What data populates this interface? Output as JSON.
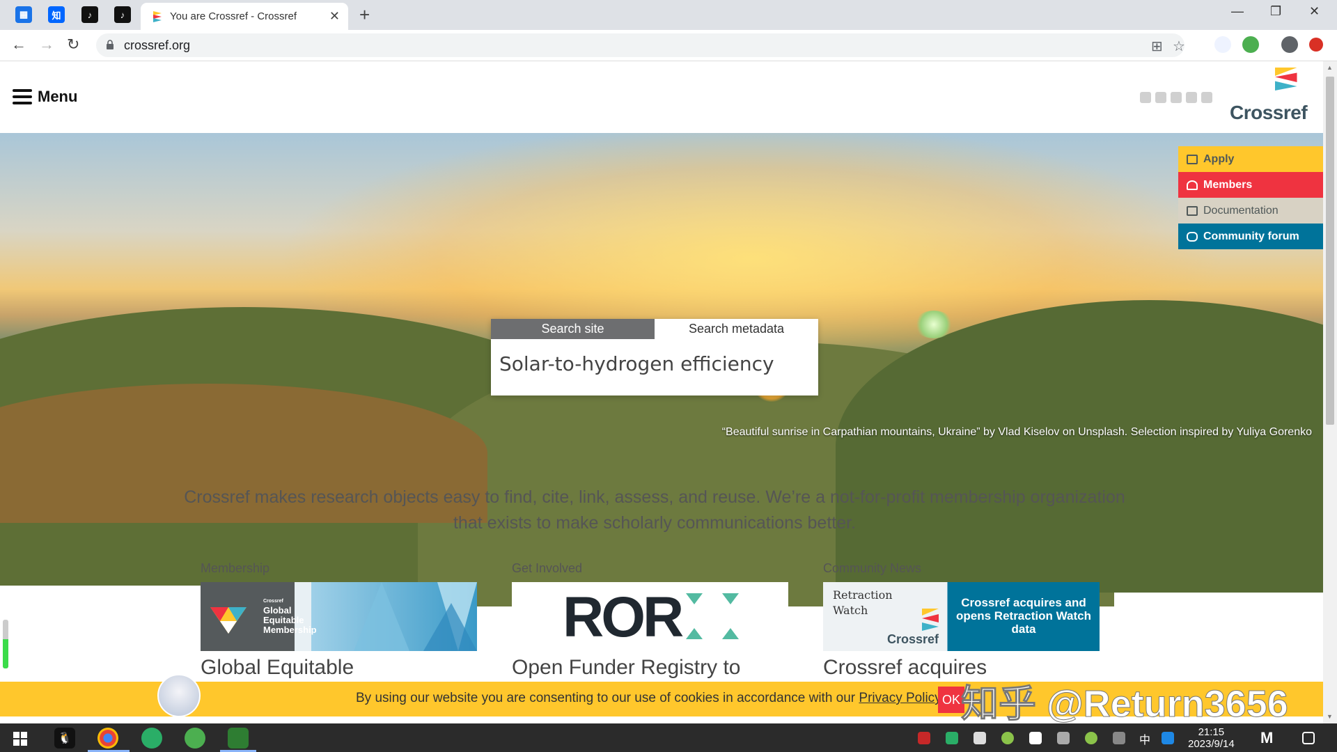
{
  "browser": {
    "tab_title": "You are Crossref - Crossref",
    "url": "crossref.org",
    "pinned_tabs": [
      {
        "name": "calendar-tab",
        "glyph": "📅",
        "color": "#1a73e8"
      },
      {
        "name": "zhihu-tab",
        "glyph": "知",
        "color": "#0066ff"
      },
      {
        "name": "tiktok-tab-1",
        "glyph": "♪",
        "color": "#111111"
      },
      {
        "name": "tiktok-tab-2",
        "glyph": "♪",
        "color": "#111111"
      }
    ]
  },
  "header": {
    "menu_label": "Menu",
    "logo_text": "Crossref",
    "social_icons": [
      "rss-icon",
      "twitter-icon",
      "facebook-icon",
      "linkedin-icon",
      "youtube-icon"
    ]
  },
  "side_nav": [
    {
      "label": "Apply",
      "bg": "#ffc72c",
      "fg": "#4f5858",
      "icon": "book-icon"
    },
    {
      "label": "Members",
      "bg": "#ef3340",
      "fg": "#ffffff",
      "icon": "user-icon"
    },
    {
      "label": "Documentation",
      "bg": "#d8d2c4",
      "fg": "#4f5858",
      "icon": "docs-icon"
    },
    {
      "label": "Community forum",
      "bg": "#00739a",
      "fg": "#ffffff",
      "icon": "chat-icon"
    }
  ],
  "search": {
    "tab_site": "Search site",
    "tab_metadata": "Search metadata",
    "active_tab": "Search metadata",
    "value": "Solar-to-hydrogen efficiency"
  },
  "hero": {
    "credit": "“Beautiful sunrise in Carpathian mountains, Ukraine” by Vlad Kiselov on Unsplash. Selection inspired by Yuliya Gorenko"
  },
  "tagline": "Crossref makes research objects easy to find, cite, link, assess, and reuse. We’re a not-for-profit membership organization that exists to make scholarly communications better.",
  "columns": [
    {
      "label": "Membership",
      "heading": "Global Equitable",
      "image_text_top": "Crossref",
      "image_text": "Global Equitable Membership"
    },
    {
      "label": "Get Involved",
      "heading": "Open Funder Registry to",
      "image_text": "ROR"
    },
    {
      "label": "Community News",
      "heading": "Crossref acquires",
      "image_text_left": "Retraction Watch",
      "image_logo_text": "Crossref",
      "image_text": "Crossref acquires and opens Retraction Watch data"
    }
  ],
  "cookie": {
    "text": "By using our website you are consenting to our use of cookies in accordance with our",
    "link": "Privacy Policy",
    "ok": "OK"
  },
  "watermark": "知乎 @Return3656",
  "taskbar": {
    "time": "21:15",
    "date": "2023/9/14",
    "ime": "中"
  },
  "colors": {
    "crossref_yellow": "#ffc72c",
    "crossref_red": "#ef3340",
    "crossref_blue": "#00739a",
    "crossref_grey": "#4f5858"
  }
}
